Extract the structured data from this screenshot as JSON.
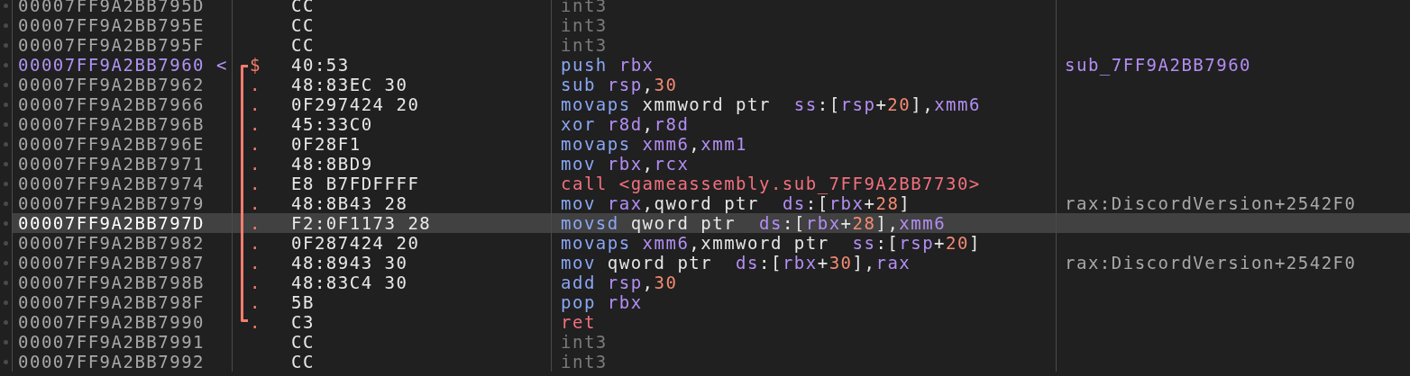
{
  "rows": [
    {
      "address": "00007FF9A2BB795D",
      "entry": false,
      "selected": false,
      "bytes": "CC",
      "disasm": [
        {
          "t": "int3",
          "kind": "filler"
        }
      ]
    },
    {
      "address": "00007FF9A2BB795E",
      "entry": false,
      "selected": false,
      "bytes": "CC",
      "disasm": [
        {
          "t": "int3",
          "kind": "filler"
        }
      ]
    },
    {
      "address": "00007FF9A2BB795F",
      "entry": false,
      "selected": false,
      "bytes": "CC",
      "disasm": [
        {
          "t": "int3",
          "kind": "filler"
        }
      ]
    },
    {
      "address": "00007FF9A2BB7960",
      "arrow": "<",
      "entry": true,
      "selected": false,
      "jump_line": {
        "kind": "start"
      },
      "marker": "$",
      "bytes": "40:53",
      "disasm": [
        {
          "t": "push",
          "kind": "mnemonic"
        },
        {
          "t": " rbx",
          "kind": "register"
        }
      ],
      "comment": {
        "text": "sub_7FF9A2BB7960",
        "kind": "label"
      }
    },
    {
      "address": "00007FF9A2BB7962",
      "entry": false,
      "selected": false,
      "jump_line": {
        "kind": "mid"
      },
      "marker": ".",
      "bytes": "48:83EC 30",
      "disasm": [
        {
          "t": "sub",
          "kind": "mnemonic"
        },
        {
          "t": " rsp",
          "kind": "register"
        },
        {
          "t": ",",
          "kind": "plain"
        },
        {
          "t": "30",
          "kind": "number"
        }
      ]
    },
    {
      "address": "00007FF9A2BB7966",
      "entry": false,
      "selected": false,
      "jump_line": {
        "kind": "mid"
      },
      "marker": ".",
      "bytes": "0F297424 20",
      "disasm": [
        {
          "t": "movaps",
          "kind": "mnemonic"
        },
        {
          "t": " xmmword ptr  ",
          "kind": "plain"
        },
        {
          "t": "ss",
          "kind": "register"
        },
        {
          "t": ":[",
          "kind": "plain"
        },
        {
          "t": "rsp",
          "kind": "register"
        },
        {
          "t": "+",
          "kind": "plain"
        },
        {
          "t": "20",
          "kind": "number"
        },
        {
          "t": "],",
          "kind": "plain"
        },
        {
          "t": "xmm6",
          "kind": "register"
        }
      ]
    },
    {
      "address": "00007FF9A2BB796B",
      "entry": false,
      "selected": false,
      "jump_line": {
        "kind": "mid"
      },
      "marker": ".",
      "bytes": "45:33C0",
      "disasm": [
        {
          "t": "xor",
          "kind": "mnemonic"
        },
        {
          "t": " r8d",
          "kind": "register"
        },
        {
          "t": ",",
          "kind": "plain"
        },
        {
          "t": "r8d",
          "kind": "register"
        }
      ]
    },
    {
      "address": "00007FF9A2BB796E",
      "entry": false,
      "selected": false,
      "jump_line": {
        "kind": "mid"
      },
      "marker": ".",
      "bytes": "0F28F1",
      "disasm": [
        {
          "t": "movaps",
          "kind": "mnemonic"
        },
        {
          "t": " xmm6",
          "kind": "register"
        },
        {
          "t": ",",
          "kind": "plain"
        },
        {
          "t": "xmm1",
          "kind": "register"
        }
      ]
    },
    {
      "address": "00007FF9A2BB7971",
      "entry": false,
      "selected": false,
      "jump_line": {
        "kind": "mid"
      },
      "marker": ".",
      "bytes": "48:8BD9",
      "disasm": [
        {
          "t": "mov",
          "kind": "mnemonic"
        },
        {
          "t": " rbx",
          "kind": "register"
        },
        {
          "t": ",",
          "kind": "plain"
        },
        {
          "t": "rcx",
          "kind": "register"
        }
      ]
    },
    {
      "address": "00007FF9A2BB7974",
      "entry": false,
      "selected": false,
      "jump_line": {
        "kind": "mid"
      },
      "marker": ".",
      "bytes": "E8 B7FDFFFF",
      "disasm": [
        {
          "t": "call <gameassembly.sub_7FF9A2BB7730>",
          "kind": "call"
        }
      ]
    },
    {
      "address": "00007FF9A2BB7979",
      "entry": false,
      "selected": false,
      "jump_line": {
        "kind": "mid"
      },
      "marker": ".",
      "bytes": "48:8B43 28",
      "disasm": [
        {
          "t": "mov",
          "kind": "mnemonic"
        },
        {
          "t": " rax",
          "kind": "register"
        },
        {
          "t": ",qword ptr  ",
          "kind": "plain"
        },
        {
          "t": "ds",
          "kind": "register"
        },
        {
          "t": ":[",
          "kind": "plain"
        },
        {
          "t": "rbx",
          "kind": "register"
        },
        {
          "t": "+",
          "kind": "plain"
        },
        {
          "t": "28",
          "kind": "number"
        },
        {
          "t": "]",
          "kind": "plain"
        }
      ],
      "comment": {
        "text": "rax:DiscordVersion+2542F0",
        "kind": "plain"
      }
    },
    {
      "address": "00007FF9A2BB797D",
      "entry": false,
      "selected": true,
      "jump_line": {
        "kind": "mid"
      },
      "marker": ".",
      "bytes": "F2:0F1173 28",
      "disasm": [
        {
          "t": "movsd",
          "kind": "mnemonic"
        },
        {
          "t": " qword ptr  ",
          "kind": "plain"
        },
        {
          "t": "ds",
          "kind": "register"
        },
        {
          "t": ":[",
          "kind": "plain"
        },
        {
          "t": "rbx",
          "kind": "register"
        },
        {
          "t": "+",
          "kind": "plain"
        },
        {
          "t": "28",
          "kind": "number"
        },
        {
          "t": "],",
          "kind": "plain"
        },
        {
          "t": "xmm6",
          "kind": "register"
        }
      ]
    },
    {
      "address": "00007FF9A2BB7982",
      "entry": false,
      "selected": false,
      "jump_line": {
        "kind": "mid"
      },
      "marker": ".",
      "bytes": "0F287424 20",
      "disasm": [
        {
          "t": "movaps",
          "kind": "mnemonic"
        },
        {
          "t": " xmm6",
          "kind": "register"
        },
        {
          "t": ",xmmword ptr  ",
          "kind": "plain"
        },
        {
          "t": "ss",
          "kind": "register"
        },
        {
          "t": ":[",
          "kind": "plain"
        },
        {
          "t": "rsp",
          "kind": "register"
        },
        {
          "t": "+",
          "kind": "plain"
        },
        {
          "t": "20",
          "kind": "number"
        },
        {
          "t": "]",
          "kind": "plain"
        }
      ]
    },
    {
      "address": "00007FF9A2BB7987",
      "entry": false,
      "selected": false,
      "jump_line": {
        "kind": "mid"
      },
      "marker": ".",
      "bytes": "48:8943 30",
      "disasm": [
        {
          "t": "mov",
          "kind": "mnemonic"
        },
        {
          "t": " qword ptr  ",
          "kind": "plain"
        },
        {
          "t": "ds",
          "kind": "register"
        },
        {
          "t": ":[",
          "kind": "plain"
        },
        {
          "t": "rbx",
          "kind": "register"
        },
        {
          "t": "+",
          "kind": "plain"
        },
        {
          "t": "30",
          "kind": "number"
        },
        {
          "t": "],",
          "kind": "plain"
        },
        {
          "t": "rax",
          "kind": "register"
        }
      ],
      "comment": {
        "text": "rax:DiscordVersion+2542F0",
        "kind": "plain"
      }
    },
    {
      "address": "00007FF9A2BB798B",
      "entry": false,
      "selected": false,
      "jump_line": {
        "kind": "mid"
      },
      "marker": ".",
      "bytes": "48:83C4 30",
      "disasm": [
        {
          "t": "add",
          "kind": "mnemonic"
        },
        {
          "t": " rsp",
          "kind": "register"
        },
        {
          "t": ",",
          "kind": "plain"
        },
        {
          "t": "30",
          "kind": "number"
        }
      ]
    },
    {
      "address": "00007FF9A2BB798F",
      "entry": false,
      "selected": false,
      "jump_line": {
        "kind": "mid"
      },
      "marker": ".",
      "bytes": "5B",
      "disasm": [
        {
          "t": "pop",
          "kind": "mnemonic"
        },
        {
          "t": " rbx",
          "kind": "register"
        }
      ]
    },
    {
      "address": "00007FF9A2BB7990",
      "entry": false,
      "selected": false,
      "jump_line": {
        "kind": "end"
      },
      "marker": ".",
      "bytes": "C3",
      "disasm": [
        {
          "t": "ret",
          "kind": "call"
        }
      ]
    },
    {
      "address": "00007FF9A2BB7991",
      "entry": false,
      "selected": false,
      "bytes": "CC",
      "disasm": [
        {
          "t": "int3",
          "kind": "filler"
        }
      ]
    },
    {
      "address": "00007FF9A2BB7992",
      "entry": false,
      "selected": false,
      "bytes": "CC",
      "disasm": [
        {
          "t": "int3",
          "kind": "filler"
        }
      ]
    }
  ]
}
